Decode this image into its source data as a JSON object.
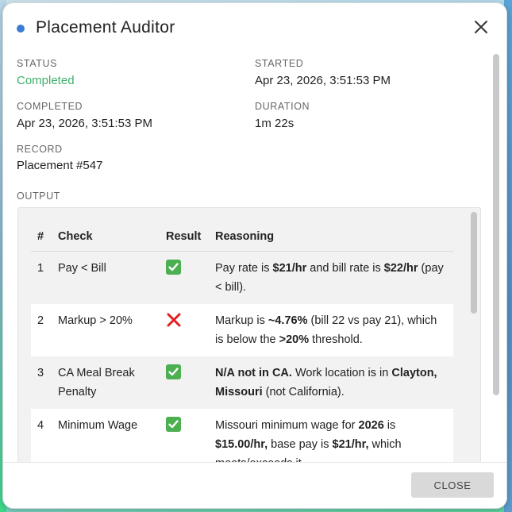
{
  "dialog": {
    "title": "Placement Auditor",
    "accent_color": "#3a7bd5",
    "close_icon": "close-icon"
  },
  "fields": {
    "status_label": "STATUS",
    "status_value": "Completed",
    "status_color": "#3fae6b",
    "started_label": "STARTED",
    "started_value": "Apr 23, 2026, 3:51:53 PM",
    "completed_label": "COMPLETED",
    "completed_value": "Apr 23, 2026, 3:51:53 PM",
    "duration_label": "DURATION",
    "duration_value": "1m 22s",
    "record_label": "RECORD",
    "record_value": "Placement #547",
    "output_label": "OUTPUT"
  },
  "table": {
    "headers": [
      "#",
      "Check",
      "Result",
      "Reasoning"
    ],
    "rows": [
      {
        "num": "1",
        "check": "Pay < Bill",
        "result": "pass",
        "reason_parts": [
          {
            "t": "Pay rate is ",
            "b": false
          },
          {
            "t": "$21/hr",
            "b": true
          },
          {
            "t": " and bill rate is ",
            "b": false
          },
          {
            "t": "$22/hr",
            "b": true
          },
          {
            "t": " (pay < bill).",
            "b": false
          }
        ]
      },
      {
        "num": "2",
        "check": "Markup > 20%",
        "result": "fail",
        "reason_parts": [
          {
            "t": "Markup is ",
            "b": false
          },
          {
            "t": "~4.76%",
            "b": true
          },
          {
            "t": " (bill 22 vs pay 21), which is below the ",
            "b": false
          },
          {
            "t": ">20%",
            "b": true
          },
          {
            "t": " threshold.",
            "b": false
          }
        ]
      },
      {
        "num": "3",
        "check": "CA Meal Break Penalty",
        "result": "pass",
        "reason_parts": [
          {
            "t": "N/A not in CA.",
            "b": true
          },
          {
            "t": " Work location is in ",
            "b": false
          },
          {
            "t": "Clayton, Missouri",
            "b": true
          },
          {
            "t": " (not California).",
            "b": false
          }
        ]
      },
      {
        "num": "4",
        "check": "Minimum Wage",
        "result": "pass",
        "reason_parts": [
          {
            "t": "Missouri minimum wage for ",
            "b": false
          },
          {
            "t": "2026",
            "b": true
          },
          {
            "t": " is ",
            "b": false
          },
          {
            "t": "$15.00/hr,",
            "b": true
          },
          {
            "t": " base pay is ",
            "b": false
          },
          {
            "t": "$21/hr,",
            "b": true
          },
          {
            "t": " which meets/exceeds it.",
            "b": false
          }
        ]
      }
    ]
  },
  "footer": {
    "close_label": "CLOSE"
  }
}
